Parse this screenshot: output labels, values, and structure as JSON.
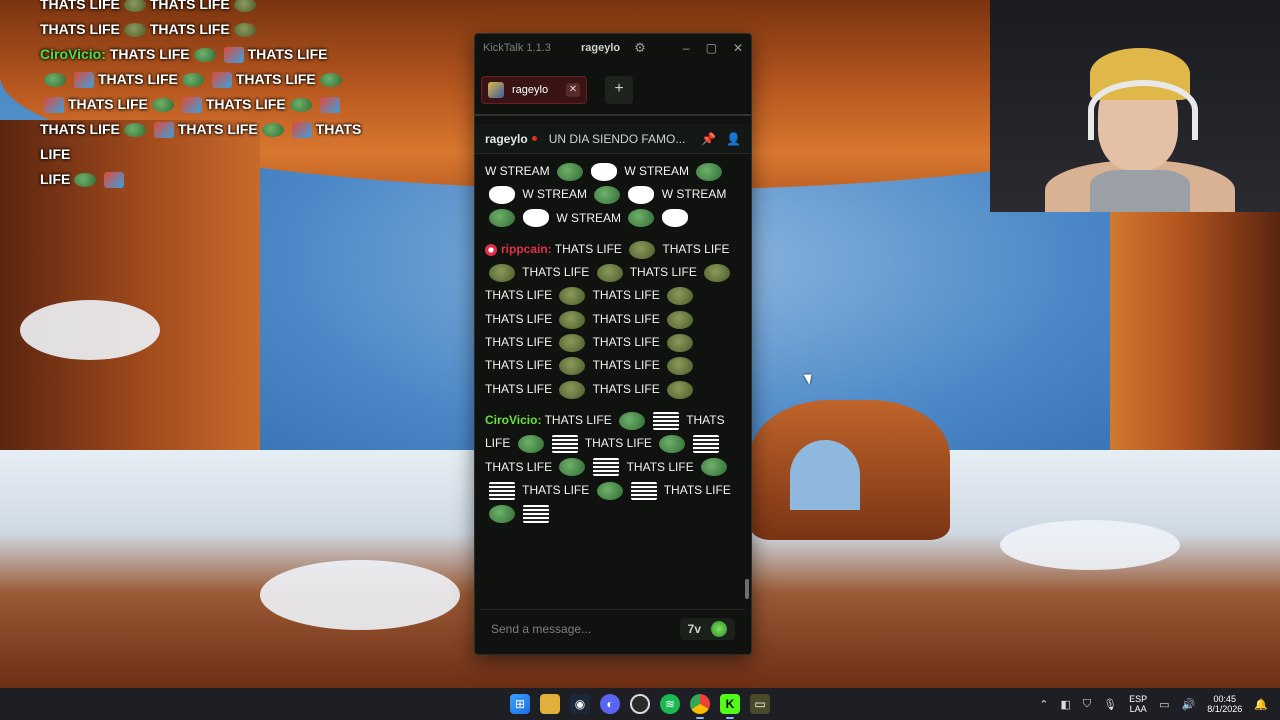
{
  "overlay_chat": {
    "line1": "THATS LIFE",
    "line2": "THATS LIFE",
    "line3": "THATS LIFE",
    "user": "CiroVicio:",
    "text": "THATS LIFE",
    "tail": "LIFE"
  },
  "kicktalk": {
    "app_title": "KickTalk 1.1.3",
    "current_user": "rageylo",
    "tab_label": "rageylo",
    "channel": {
      "name": "rageylo",
      "title": "UN DIA SIENDO FAMO..."
    },
    "messages": [
      {
        "user": "",
        "text": "W STREAM",
        "emote": "stream-emote"
      },
      {
        "user": "rippcain:",
        "text": "THATS LIFE",
        "emote": "frog-emote"
      },
      {
        "user": "CiroVicio:",
        "text": "THATS LIFE",
        "emote": "cash-emote"
      }
    ],
    "input_placeholder": "Send a message...",
    "send_emote_button": "emote-picker",
    "seventv_label": "7v"
  },
  "taskbar": {
    "lang": "ESP",
    "lang2": "LAA",
    "time": "00:45",
    "date": "8/1/2026"
  },
  "colors": {
    "kick_green": "#53fc18",
    "red_user": "#e0304a",
    "green_user": "#6be040"
  }
}
